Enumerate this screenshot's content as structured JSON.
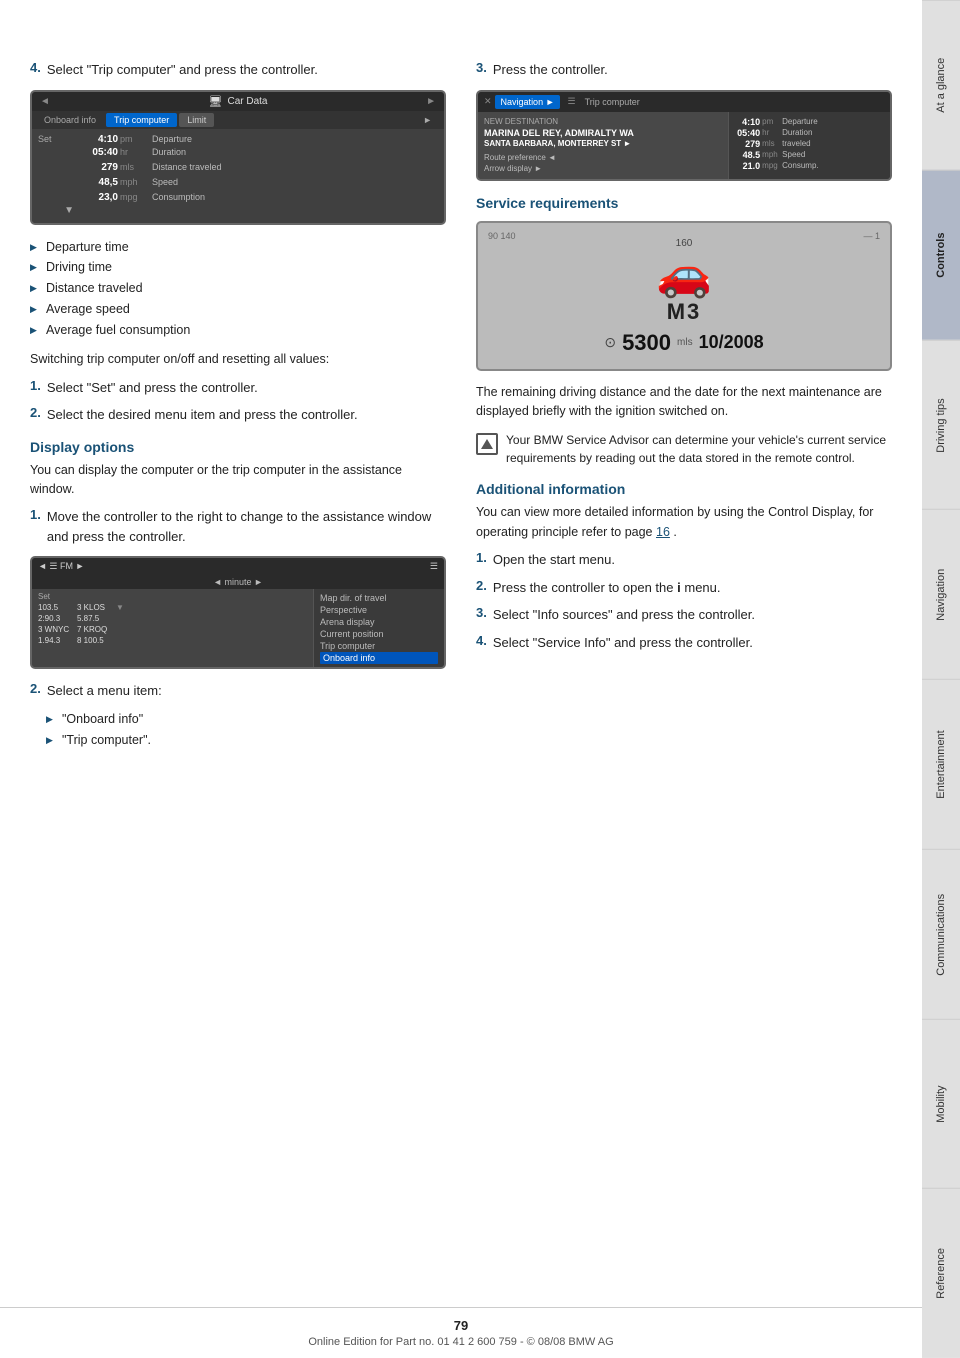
{
  "page": {
    "number": "79",
    "footer_text": "Online Edition for Part no. 01 41 2 600 759 - © 08/08 BMW AG"
  },
  "sidebar": {
    "tabs": [
      {
        "label": "At a glance",
        "active": false
      },
      {
        "label": "Controls",
        "active": true
      },
      {
        "label": "Driving tips",
        "active": false
      },
      {
        "label": "Navigation",
        "active": false
      },
      {
        "label": "Entertainment",
        "active": false
      },
      {
        "label": "Communications",
        "active": false
      },
      {
        "label": "Mobility",
        "active": false
      },
      {
        "label": "Reference",
        "active": false
      }
    ]
  },
  "left_col": {
    "step4": {
      "number": "4.",
      "text": "Select \"Trip computer\" and press the controller."
    },
    "car_data_screen": {
      "title": "Car Data",
      "tabs": [
        "Onboard info",
        "Trip computer",
        "Limit"
      ],
      "active_tab": "Trip computer",
      "set_label": "Set",
      "rows": [
        {
          "val": "4:10",
          "unit": "pm",
          "desc": "Departure"
        },
        {
          "val": "05:40",
          "unit": "hr",
          "desc": "Duration"
        },
        {
          "val": "279",
          "unit": "mls",
          "desc": "Distance traveled"
        },
        {
          "val": "48,5",
          "unit": "mph",
          "desc": "Speed"
        },
        {
          "val": "23,0",
          "unit": "mpg",
          "desc": "Consumption"
        }
      ]
    },
    "bullets": [
      "Departure time",
      "Driving time",
      "Distance traveled",
      "Average speed",
      "Average fuel consumption"
    ],
    "switching_text": "Switching trip computer on/off and resetting all values:",
    "steps_1_2": [
      {
        "number": "1.",
        "text": "Select \"Set\" and press the controller."
      },
      {
        "number": "2.",
        "text": "Select the desired menu item and press the controller."
      }
    ],
    "display_options": {
      "heading": "Display options",
      "text": "You can display the computer or the trip computer in the assistance window."
    },
    "step1_display": {
      "number": "1.",
      "text": "Move the controller to the right to change to the assistance window and press the controller."
    },
    "assist_screen": {
      "header_left": "FM",
      "header_right": "",
      "sub_header": "< minute >",
      "rows_left": [
        {
          "label": "103.5",
          "val2": "3 KLOS"
        },
        {
          "label": "2:90.3",
          "val2": "5.87.5"
        },
        {
          "label": "3 WNYC",
          "val2": "7 KROQ"
        },
        {
          "label": "1.94.3",
          "val2": "8 100.5"
        }
      ],
      "menu_items": [
        "Map dir. of travel",
        "Perspective",
        "Arena display",
        "Current position",
        "Trip computer",
        {
          "label": "Onboard info",
          "selected": true
        }
      ]
    },
    "step2": {
      "number": "2.",
      "text": "Select a menu item:",
      "sub_bullets": [
        "\"Onboard info\"",
        "\"Trip computer\"."
      ]
    }
  },
  "right_col": {
    "step3": {
      "number": "3.",
      "text": "Press the controller."
    },
    "nav_screen": {
      "tab1": "Navigation",
      "tab2": "Trip computer",
      "dest_label": "New destination",
      "dest_line1": "MARINA DEL REY, ADMIRALTY WA",
      "dest_line2": "SANTA BARBARA, MONTERREY ST",
      "route_items": [
        "Route preference ◄",
        "Arrow display ◄"
      ],
      "trip_rows": [
        {
          "val": "4:10",
          "unit": "pm",
          "desc": "Departure"
        },
        {
          "val": "05:40",
          "unit": "hr",
          "desc": "Duration"
        },
        {
          "val": "279",
          "unit": "mls",
          "desc": "traveled"
        },
        {
          "val": "48.5",
          "unit": "mph",
          "desc": "Speed"
        },
        {
          "val": "21.0",
          "unit": "mpg",
          "desc": "Consump."
        }
      ]
    },
    "service_requirements": {
      "heading": "Service requirements",
      "model": "M3",
      "mileage": "5300",
      "mileage_unit": "mls",
      "date": "10/2008",
      "text": "The remaining driving distance and the date for the next maintenance are displayed briefly with the ignition switched on."
    },
    "note": {
      "text": "Your BMW Service Advisor can determine your vehicle's current service requirements by reading out the data stored in the remote control."
    },
    "additional_info": {
      "heading": "Additional information",
      "text": "You can view more detailed information by using the Control Display, for operating principle refer to page",
      "page_link": "16",
      "text_after": ".",
      "steps": [
        {
          "number": "1.",
          "text": "Open the start menu."
        },
        {
          "number": "2.",
          "text": "Press the controller to open the i menu."
        },
        {
          "number": "3.",
          "text": "Select \"Info sources\" and press the controller."
        },
        {
          "number": "4.",
          "text": "Select \"Service Info\" and press the controller."
        }
      ]
    }
  }
}
